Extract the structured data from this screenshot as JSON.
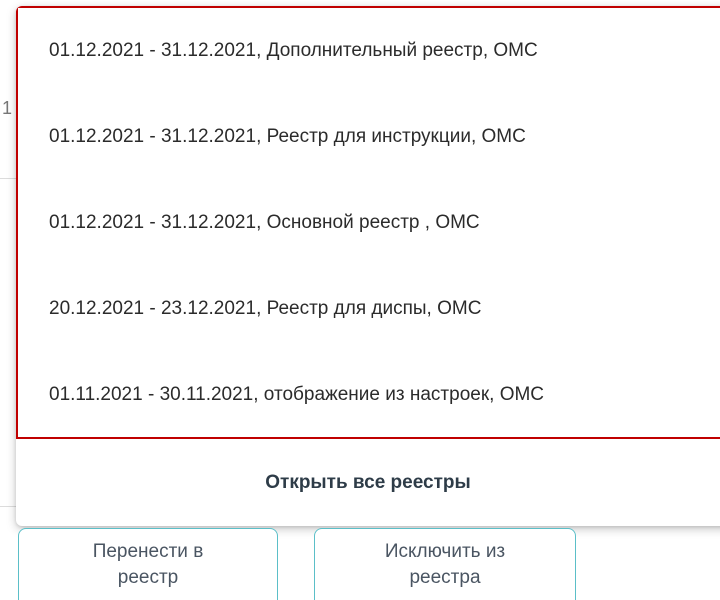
{
  "dropdown": {
    "items": [
      {
        "label": "01.12.2021 - 31.12.2021, Дополнительный реестр, ОМС"
      },
      {
        "label": "01.12.2021 - 31.12.2021, Реестр для инструкции, ОМС"
      },
      {
        "label": "01.12.2021 - 31.12.2021, Основной реестр , ОМС"
      },
      {
        "label": "20.12.2021 - 23.12.2021, Реестр для диспы, ОМС"
      },
      {
        "label": "01.11.2021 - 30.11.2021, отображение из настроек, ОМС"
      }
    ],
    "open_all_label": "Открыть все реестры"
  },
  "actions": {
    "move_to_registry": [
      "Перенести в",
      "реестр"
    ],
    "exclude_from_registry": [
      "Исключить из",
      "реестра"
    ]
  },
  "background": {
    "partial_glyph": "1"
  },
  "colors": {
    "highlight_border": "#c00000",
    "button_border": "#5bbfc8",
    "text": "#2b2b2b",
    "open_all_text": "#2e3c48"
  }
}
